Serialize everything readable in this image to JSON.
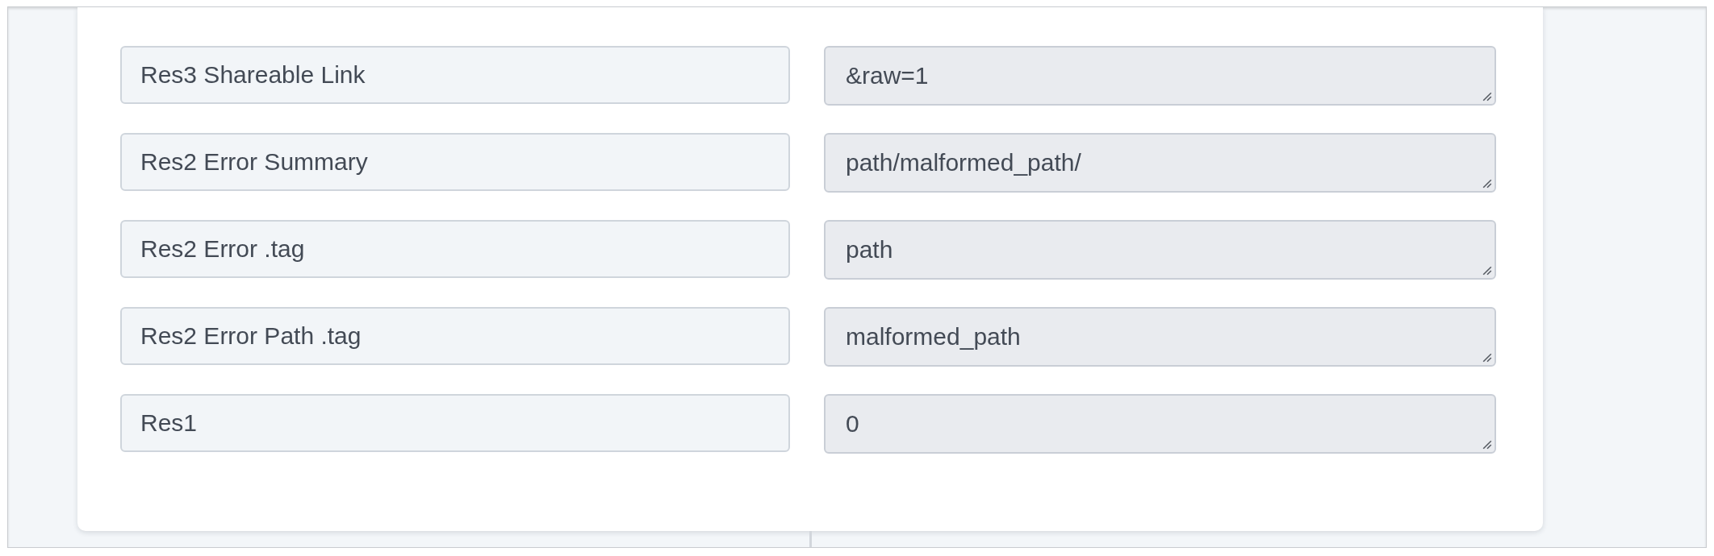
{
  "rows": [
    {
      "label": "Res3 Shareable Link",
      "value": "&raw=1"
    },
    {
      "label": "Res2 Error Summary",
      "value": "path/malformed_path/"
    },
    {
      "label": "Res2 Error .tag",
      "value": "path"
    },
    {
      "label": "Res2 Error Path .tag",
      "value": "malformed_path"
    },
    {
      "label": "Res1",
      "value": "0"
    }
  ]
}
